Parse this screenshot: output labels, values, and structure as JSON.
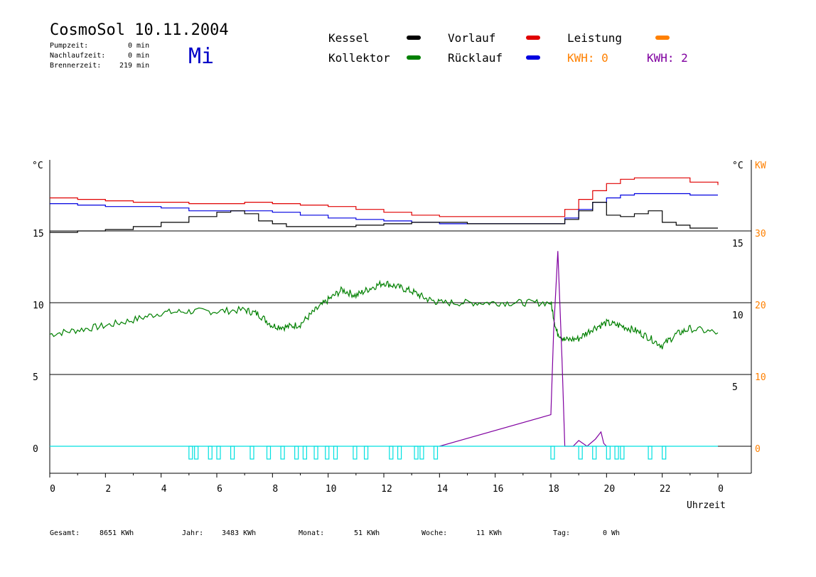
{
  "header": {
    "title": "CosmoSol 10.11.2004",
    "day": "Mi",
    "stats": [
      {
        "label": "Pumpzeit:",
        "value": "0 min"
      },
      {
        "label": "Nachlaufzeit:",
        "value": "0 min"
      },
      {
        "label": "Brennerzeit:",
        "value": "219 min"
      }
    ]
  },
  "legend": {
    "items": [
      {
        "label": "Kessel",
        "color": "#000000"
      },
      {
        "label": "Vorlauf",
        "color": "#e00000"
      },
      {
        "label": "Leistung",
        "color": "#ff8000"
      },
      {
        "label": "Kollektor",
        "color": "#008000"
      },
      {
        "label": "Rücklauf",
        "color": "#0000e0"
      }
    ],
    "kwh_orange": {
      "text": "KWH: 0",
      "color": "#ff8000"
    },
    "kwh_purple": {
      "text": "KWH: 2",
      "color": "#8000a0"
    }
  },
  "footer": [
    {
      "label": "Gesamt:",
      "value": "8651 KWh"
    },
    {
      "label": "Jahr:",
      "value": "3483 KWh"
    },
    {
      "label": "Monat:",
      "value": "51 KWh"
    },
    {
      "label": "Woche:",
      "value": "11 KWh"
    },
    {
      "label": "Tag:",
      "value": "0 Wh"
    }
  ],
  "chart_data": {
    "type": "line",
    "xlabel": "Uhrzeit",
    "x_ticks": [
      "0",
      "2",
      "4",
      "6",
      "8",
      "10",
      "12",
      "14",
      "16",
      "18",
      "20",
      "22",
      "0"
    ],
    "xlim": [
      0,
      24
    ],
    "left_axis": {
      "label": "°C",
      "ticks": [
        "15",
        "10",
        "5",
        "0"
      ]
    },
    "right_axis_temp": {
      "label": "°C",
      "ticks": [
        "15",
        "10",
        "5"
      ]
    },
    "right_axis_power": {
      "label": "KW",
      "ticks": [
        "30",
        "20",
        "10",
        "0"
      ],
      "color": "#ff8000"
    },
    "colors": {
      "kessel": "#000000",
      "vorlauf": "#e00000",
      "ruecklauf": "#0000e0",
      "kollektor": "#008000",
      "kwh": "#8000a0",
      "pump": "#00e0e0",
      "grid": "#000000"
    },
    "series": [
      {
        "key": "vorlauf",
        "x": [
          0,
          1,
          2,
          3,
          4,
          5,
          6,
          7,
          8,
          9,
          10,
          11,
          12,
          13,
          14,
          15,
          16,
          17,
          18,
          18.5,
          19,
          19.5,
          20,
          20.5,
          21,
          22,
          23,
          24
        ],
        "y": [
          17.3,
          17.2,
          17.1,
          17.0,
          17.0,
          16.9,
          16.9,
          17.0,
          16.9,
          16.8,
          16.7,
          16.5,
          16.3,
          16.1,
          16.0,
          16.0,
          16.0,
          16.0,
          16.0,
          16.5,
          17.2,
          17.8,
          18.3,
          18.6,
          18.7,
          18.7,
          18.4,
          18.2
        ]
      },
      {
        "key": "ruecklauf",
        "x": [
          0,
          1,
          2,
          3,
          4,
          5,
          6,
          7,
          8,
          9,
          10,
          11,
          12,
          13,
          14,
          15,
          16,
          17,
          18,
          18.5,
          19,
          19.5,
          20,
          20.5,
          21,
          22,
          23,
          24
        ],
        "y": [
          16.9,
          16.8,
          16.7,
          16.7,
          16.6,
          16.4,
          16.4,
          16.4,
          16.3,
          16.1,
          15.9,
          15.8,
          15.7,
          15.6,
          15.5,
          15.5,
          15.5,
          15.5,
          15.5,
          15.9,
          16.5,
          17.0,
          17.3,
          17.5,
          17.6,
          17.6,
          17.5,
          17.5
        ]
      },
      {
        "key": "kessel",
        "x": [
          0,
          1,
          2,
          3,
          4,
          5,
          6,
          6.5,
          7,
          7.5,
          8,
          8.5,
          9,
          10,
          11,
          12,
          13,
          14,
          15,
          16,
          17,
          18,
          18.5,
          19,
          19.5,
          20,
          20.5,
          21,
          21.5,
          22,
          22.5,
          23,
          24
        ],
        "y": [
          14.9,
          15.0,
          15.1,
          15.3,
          15.6,
          16.0,
          16.3,
          16.4,
          16.2,
          15.7,
          15.5,
          15.3,
          15.3,
          15.3,
          15.4,
          15.5,
          15.6,
          15.6,
          15.5,
          15.5,
          15.5,
          15.5,
          15.8,
          16.4,
          17.0,
          16.1,
          16.0,
          16.2,
          16.4,
          15.6,
          15.4,
          15.2,
          15.2
        ]
      },
      {
        "key": "kollektor",
        "x": [
          0,
          1,
          2,
          3,
          4,
          5,
          6,
          7,
          7.5,
          8,
          8.5,
          9,
          9.5,
          10,
          10.5,
          11,
          11.5,
          12,
          12.5,
          13,
          13.5,
          14,
          15,
          16,
          17,
          18,
          18.2,
          18.5,
          19,
          19.5,
          20,
          20.5,
          21,
          21.5,
          22,
          22.5,
          23,
          24
        ],
        "y": [
          7.8,
          8.1,
          8.4,
          8.8,
          9.3,
          9.4,
          9.4,
          9.5,
          9.2,
          8.4,
          8.3,
          8.5,
          9.4,
          10.2,
          10.9,
          10.5,
          11.0,
          11.4,
          11.1,
          10.8,
          10.3,
          10.0,
          10.0,
          10.0,
          10.0,
          10.0,
          8.0,
          7.4,
          7.5,
          8.2,
          8.6,
          8.4,
          8.1,
          7.6,
          7.0,
          7.8,
          8.2,
          7.9
        ]
      },
      {
        "key": "kwh",
        "x": [
          14,
          18,
          18.1,
          18.25,
          18.4,
          18.5,
          18.8,
          19,
          19.3,
          19.6,
          19.8,
          19.9,
          20
        ],
        "y": [
          0,
          2.2,
          8,
          13.6,
          6,
          0,
          0,
          0.4,
          0,
          0.5,
          1.0,
          0.2,
          0
        ]
      }
    ],
    "pump_pulses": [
      5.0,
      5.2,
      5.7,
      6.0,
      6.5,
      7.2,
      7.8,
      8.3,
      8.8,
      9.1,
      9.5,
      9.9,
      10.2,
      10.9,
      11.3,
      12.2,
      12.5,
      13.1,
      13.3,
      13.8,
      18.0,
      19.0,
      19.5,
      20.0,
      20.3,
      20.5,
      21.5,
      22.0
    ]
  }
}
